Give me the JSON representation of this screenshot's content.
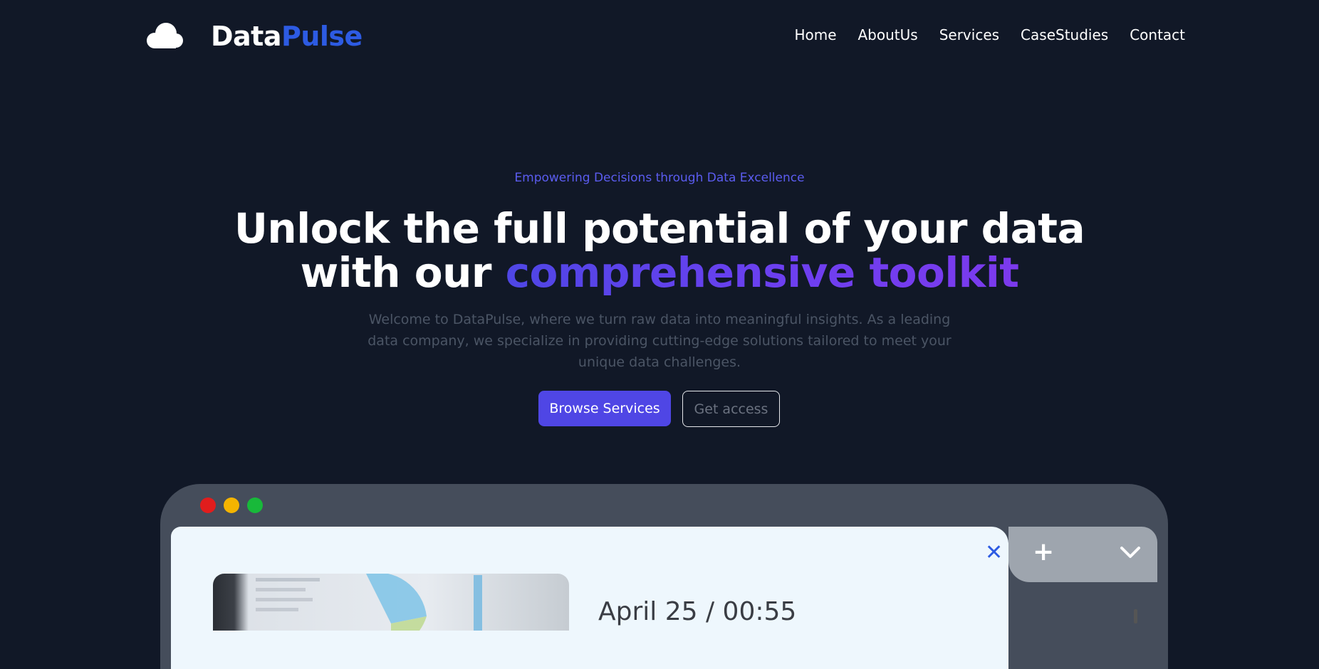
{
  "brand": {
    "name_part1": "Data",
    "name_part2": "Pulse",
    "logo_icon": "cloud-icon"
  },
  "nav": {
    "items": [
      {
        "label": "Home"
      },
      {
        "label": "AboutUs"
      },
      {
        "label": "Services"
      },
      {
        "label": "CaseStudies"
      },
      {
        "label": "Contact"
      }
    ]
  },
  "hero": {
    "tagline": "Empowering Decisions through Data Excellence",
    "headline_line1": "Unlock the full potential of your data",
    "headline_line2_plain": "with our ",
    "headline_line2_highlight": "comprehensive toolkit",
    "lead": "Welcome to DataPulse, where we turn raw data into meaningful insights. As a leading data company, we specialize in providing cutting-edge solutions tailored to meet your unique data challenges.",
    "primary_cta": "Browse Services",
    "secondary_cta": "Get access"
  },
  "mock_window": {
    "close_icon": "close-icon",
    "add_icon": "plus-icon",
    "menu_icon": "chevron-down-icon",
    "datetime": "April 25 / 00:55"
  },
  "colors": {
    "background": "#111827",
    "accent": "#4f46e5",
    "brand_blue": "#2d5be3",
    "gradient_end": "#7c3aed"
  }
}
